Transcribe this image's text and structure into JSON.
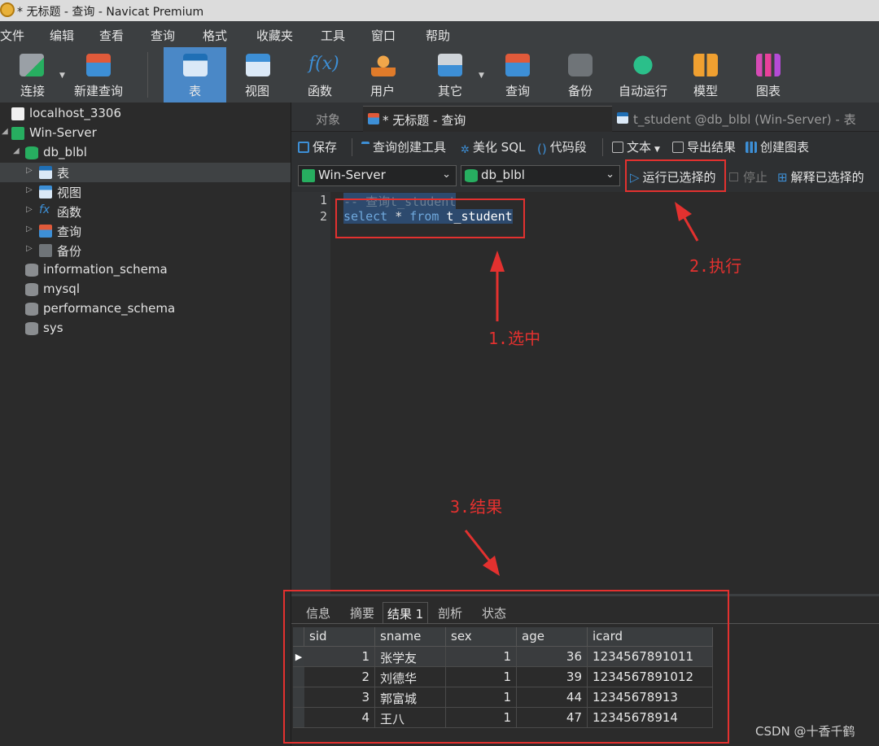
{
  "window": {
    "title": "* 无标题 - 查询 - Navicat Premium"
  },
  "menu": [
    "文件",
    "编辑",
    "查看",
    "查询",
    "格式",
    "收藏夹",
    "工具",
    "窗口",
    "帮助"
  ],
  "toolbar": {
    "connect": "连接",
    "new_query": "新建查询",
    "table": "表",
    "view": "视图",
    "function": "函数",
    "user": "用户",
    "other": "其它",
    "query": "查询",
    "backup": "备份",
    "auto_run": "自动运行",
    "model": "模型",
    "chart": "图表"
  },
  "nav": {
    "connections": [
      {
        "label": "localhost_3306"
      },
      {
        "label": "Win-Server"
      }
    ],
    "database": "db_blbl",
    "objects": [
      "表",
      "视图",
      "函数",
      "查询",
      "备份"
    ],
    "other_dbs": [
      "information_schema",
      "mysql",
      "performance_schema",
      "sys"
    ]
  },
  "tabs": {
    "objects": "对象",
    "query": "* 无标题 - 查询",
    "table": "t_student @db_blbl (Win-Server) - 表"
  },
  "query_toolbar": {
    "save": "保存",
    "query_builder": "查询创建工具",
    "beautify": "美化 SQL",
    "snippet": "代码段",
    "text": "文本",
    "export": "导出结果",
    "create_chart": "创建图表"
  },
  "selectors": {
    "connection": "Win-Server",
    "database": "db_blbl",
    "run_selected": "运行已选择的",
    "stop": "停止",
    "explain_selected": "解释已选择的"
  },
  "editor": {
    "lines": [
      {
        "no": "1",
        "text": "-- 查询t_student"
      },
      {
        "no": "2",
        "kw1": "select",
        "op": " * ",
        "kw2": "from",
        "ident": " t_student"
      }
    ]
  },
  "results": {
    "tabs": [
      "信息",
      "摘要",
      "结果 1",
      "剖析",
      "状态"
    ],
    "columns": [
      "sid",
      "sname",
      "sex",
      "age",
      "icard"
    ],
    "rows": [
      [
        "1",
        "张学友",
        "1",
        "36",
        "1234567891011"
      ],
      [
        "2",
        "刘德华",
        "1",
        "39",
        "1234567891012"
      ],
      [
        "3",
        "郭富城",
        "1",
        "44",
        "12345678913"
      ],
      [
        "4",
        "王八",
        "1",
        "47",
        "12345678914"
      ]
    ]
  },
  "annotations": {
    "select": "1.选中",
    "execute": "2.执行",
    "result": "3.结果"
  },
  "watermark": "CSDN @十香千鹤",
  "colors": {
    "annotation_red": "#e3312f",
    "active_button": "#4a88c7",
    "selection": "#2d4a6e"
  }
}
